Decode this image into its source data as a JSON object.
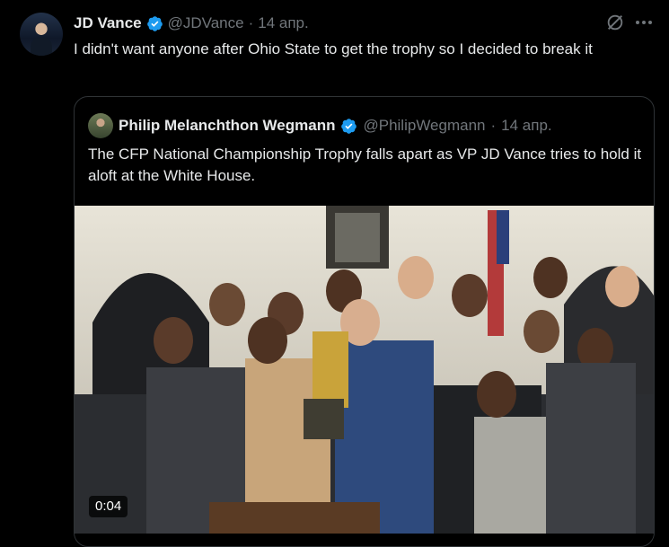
{
  "tweet": {
    "author_name": "JD Vance",
    "author_handle": "@JDVance",
    "dot": "·",
    "time": "14 апр.",
    "text": "I didn't want anyone after Ohio State to get the trophy so I decided to break it"
  },
  "quote": {
    "author_name": "Philip Melanchthon Wegmann",
    "author_handle": "@PhilipWegmann",
    "dot": "·",
    "time": "14 апр.",
    "text": "The CFP National Championship Trophy falls apart as VP JD Vance tries to hold it aloft at the White House.",
    "video_duration": "0:04"
  },
  "icons": {
    "verified": "verified-badge-icon",
    "grok": "grok-icon",
    "more": "more-options-icon"
  },
  "colors": {
    "background": "#000000",
    "text_primary": "#e7e9ea",
    "text_secondary": "#71767b",
    "verified_blue": "#1d9bf0",
    "border": "#2f3336"
  }
}
